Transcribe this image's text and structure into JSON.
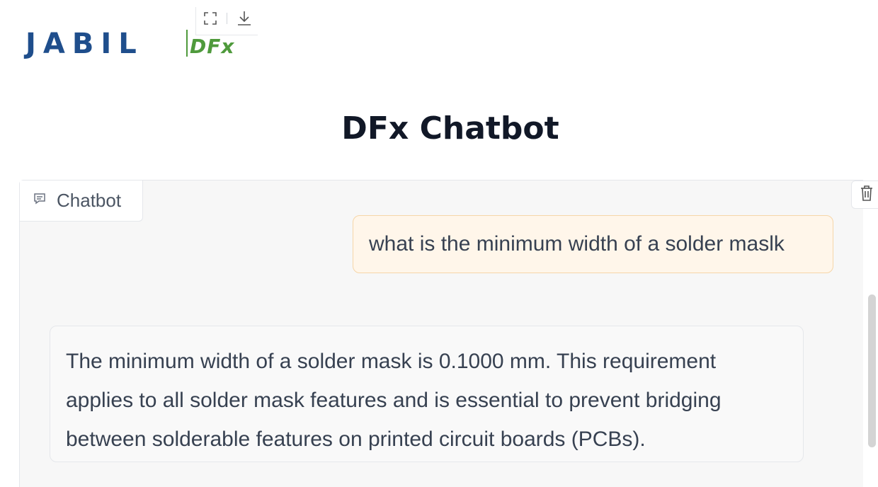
{
  "logo": {
    "brand": "JABIL",
    "product": "DFx",
    "fullscreen_icon": "fullscreen-icon",
    "download_icon": "download-icon"
  },
  "header": {
    "title": "DFx Chatbot"
  },
  "chat": {
    "tab_label": "Chatbot",
    "tab_icon": "chat-bubble-icon",
    "clear_icon": "trash-icon",
    "messages": [
      {
        "role": "user",
        "text": "what is the minimum width of a solder maslk"
      },
      {
        "role": "bot",
        "text": "The minimum width of a solder mask is 0.1000 mm. This requirement applies to all solder mask features and is essential to prevent bridging between solderable features on printed circuit boards (PCBs)."
      }
    ]
  },
  "colors": {
    "brand_blue": "#1f4e8c",
    "brand_green": "#4f9a3c",
    "user_bubble": "#fff6ea",
    "user_bubble_border": "#f6d6a8"
  }
}
